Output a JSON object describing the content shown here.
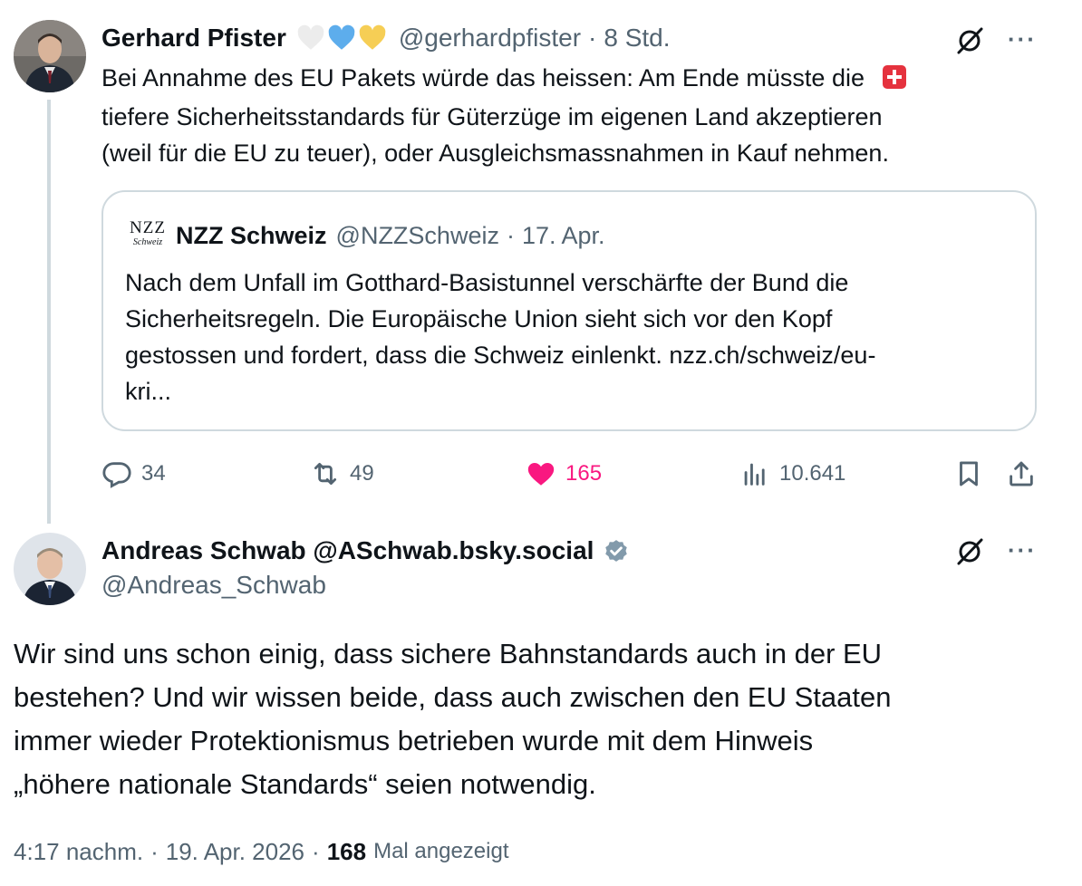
{
  "tweet1": {
    "author_name": "Gerhard Pfister",
    "handle": "@gerhardpfister",
    "separator": "·",
    "time": "8 Std.",
    "text_lines": [
      "Bei Annahme des EU Pakets würde das heissen: Am Ende müsste die",
      "tiefere Sicherheitsstandards für Güterzüge im eigenen Land akzeptieren",
      "(weil für die EU zu teuer), oder Ausgleichsmassnahmen in Kauf nehmen."
    ],
    "quote": {
      "logo_line1": "NZZ",
      "logo_line2": "Schweiz",
      "author_name": "NZZ Schweiz",
      "handle": "@NZZSchweiz",
      "separator": "·",
      "time": "17. Apr.",
      "text_lines": [
        "Nach dem Unfall im Gotthard-Basistunnel verschärfte der Bund die",
        "Sicherheitsregeln. Die Europäische Union sieht sich vor den Kopf",
        "gestossen und fordert, dass die Schweiz einlenkt. nzz.ch/schweiz/eu-",
        "kri..."
      ]
    },
    "actions": {
      "replies": "34",
      "retweets": "49",
      "likes": "165",
      "views": "10.641"
    },
    "more_label": "···"
  },
  "tweet2": {
    "author_name": "Andreas Schwab @ASchwab.bsky.social",
    "handle": "@Andreas_Schwab",
    "text_lines": [
      "Wir sind uns schon einig, dass sichere Bahnstandards auch in der EU",
      "bestehen? Und wir wissen beide, dass auch zwischen den EU Staaten",
      "immer wieder Protektionismus betrieben wurde mit dem Hinweis",
      "„höhere nationale Standards“ seien notwendig."
    ],
    "more_label": "···",
    "meta": {
      "time": "4:17 nachm.",
      "sep1": "·",
      "date": "19. Apr. 2026",
      "sep2": "·",
      "views_count": "168",
      "views_label": "Mal angezeigt"
    }
  },
  "colors": {
    "text": "#0f1419",
    "secondary": "#536471",
    "like": "#f91880",
    "verified": "#829aab",
    "border": "#cfd9de"
  }
}
